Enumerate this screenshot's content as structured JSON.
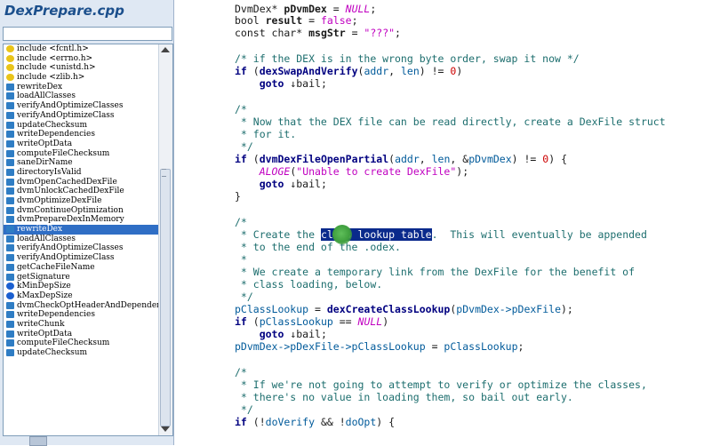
{
  "sidebar": {
    "file_title": "DexPrepare.cpp",
    "symbols": [
      {
        "icon": "include-icon",
        "label": "include <fcntl.h>"
      },
      {
        "icon": "include-icon",
        "label": "include <errno.h>"
      },
      {
        "icon": "include-icon",
        "label": "include <unistd.h>"
      },
      {
        "icon": "include-icon",
        "label": "include <zlib.h>"
      },
      {
        "icon": "method-icon",
        "label": "rewriteDex"
      },
      {
        "icon": "method-icon",
        "label": "loadAllClasses"
      },
      {
        "icon": "method-icon",
        "label": "verifyAndOptimizeClasses"
      },
      {
        "icon": "method-icon",
        "label": "verifyAndOptimizeClass"
      },
      {
        "icon": "method-icon",
        "label": "updateChecksum"
      },
      {
        "icon": "method-icon",
        "label": "writeDependencies"
      },
      {
        "icon": "method-icon",
        "label": "writeOptData"
      },
      {
        "icon": "method-icon",
        "label": "computeFileChecksum"
      },
      {
        "icon": "method-icon",
        "label": "saneDirName"
      },
      {
        "icon": "method-icon",
        "label": "directoryIsValid"
      },
      {
        "icon": "method-icon",
        "label": "dvmOpenCachedDexFile"
      },
      {
        "icon": "method-icon",
        "label": "dvmUnlockCachedDexFile"
      },
      {
        "icon": "method-icon",
        "label": "dvmOptimizeDexFile"
      },
      {
        "icon": "method-icon",
        "label": "dvmContinueOptimization"
      },
      {
        "icon": "method-icon",
        "label": "dvmPrepareDexInMemory"
      },
      {
        "icon": "method-icon",
        "label": "rewriteDex",
        "selected": true
      },
      {
        "icon": "method-icon",
        "label": "loadAllClasses"
      },
      {
        "icon": "method-icon",
        "label": "verifyAndOptimizeClasses"
      },
      {
        "icon": "method-icon",
        "label": "verifyAndOptimizeClass"
      },
      {
        "icon": "method-icon",
        "label": "getCacheFileName"
      },
      {
        "icon": "method-icon",
        "label": "getSignature"
      },
      {
        "icon": "variable-icon",
        "label": "kMinDepSize"
      },
      {
        "icon": "variable-icon",
        "label": "kMaxDepSize"
      },
      {
        "icon": "method-icon",
        "label": "dvmCheckOptHeaderAndDependencies"
      },
      {
        "icon": "method-icon",
        "label": "writeDependencies"
      },
      {
        "icon": "method-icon",
        "label": "writeChunk"
      },
      {
        "icon": "method-icon",
        "label": "writeOptData"
      },
      {
        "icon": "method-icon",
        "label": "computeFileChecksum"
      },
      {
        "icon": "method-icon",
        "label": "updateChecksum"
      }
    ]
  },
  "code": {
    "lines": [
      [
        {
          "c": "pl",
          "t": "DvmDex* "
        },
        {
          "c": "bold",
          "t": "pDvmDex"
        },
        {
          "c": "pl",
          "t": " = "
        },
        {
          "c": "macro",
          "t": "NULL"
        },
        {
          "c": "pl",
          "t": ";"
        }
      ],
      [
        {
          "c": "pl",
          "t": "bool "
        },
        {
          "c": "bold",
          "t": "result"
        },
        {
          "c": "pl",
          "t": " = "
        },
        {
          "c": "str",
          "t": "false"
        },
        {
          "c": "pl",
          "t": ";"
        }
      ],
      [
        {
          "c": "pl",
          "t": "const char* "
        },
        {
          "c": "bold",
          "t": "msgStr"
        },
        {
          "c": "pl",
          "t": " = "
        },
        {
          "c": "str",
          "t": "\"???\""
        },
        {
          "c": "pl",
          "t": ";"
        }
      ],
      [],
      [
        {
          "c": "cmt",
          "t": "/* if the DEX is in the wrong byte order, swap it now */"
        }
      ],
      [
        {
          "c": "kw",
          "t": "if"
        },
        {
          "c": "pl",
          "t": " ("
        },
        {
          "c": "fn",
          "t": "dexSwapAndVerify"
        },
        {
          "c": "pl",
          "t": "("
        },
        {
          "c": "var",
          "t": "addr"
        },
        {
          "c": "pl",
          "t": ", "
        },
        {
          "c": "var",
          "t": "len"
        },
        {
          "c": "pl",
          "t": ") != "
        },
        {
          "c": "num",
          "t": "0"
        },
        {
          "c": "pl",
          "t": ")"
        }
      ],
      [
        {
          "c": "pl",
          "t": "    "
        },
        {
          "c": "kw",
          "t": "goto"
        },
        {
          "c": "pl",
          "t": " ↓bail;"
        }
      ],
      [],
      [
        {
          "c": "cmt",
          "t": "/*"
        }
      ],
      [
        {
          "c": "cmt",
          "t": " * Now that the DEX file can be read directly, create a DexFile struct"
        }
      ],
      [
        {
          "c": "cmt",
          "t": " * for it."
        }
      ],
      [
        {
          "c": "cmt",
          "t": " */"
        }
      ],
      [
        {
          "c": "kw",
          "t": "if"
        },
        {
          "c": "pl",
          "t": " ("
        },
        {
          "c": "fn",
          "t": "dvmDexFileOpenPartial"
        },
        {
          "c": "pl",
          "t": "("
        },
        {
          "c": "var",
          "t": "addr"
        },
        {
          "c": "pl",
          "t": ", "
        },
        {
          "c": "var",
          "t": "len"
        },
        {
          "c": "pl",
          "t": ", &"
        },
        {
          "c": "var",
          "t": "pDvmDex"
        },
        {
          "c": "pl",
          "t": ") != "
        },
        {
          "c": "num",
          "t": "0"
        },
        {
          "c": "pl",
          "t": ") {"
        }
      ],
      [
        {
          "c": "pl",
          "t": "    "
        },
        {
          "c": "macro",
          "t": "ALOGE"
        },
        {
          "c": "pl",
          "t": "("
        },
        {
          "c": "str",
          "t": "\"Unable to create DexFile\""
        },
        {
          "c": "pl",
          "t": ");"
        }
      ],
      [
        {
          "c": "pl",
          "t": "    "
        },
        {
          "c": "kw",
          "t": "goto"
        },
        {
          "c": "pl",
          "t": " ↓bail;"
        }
      ],
      [
        {
          "c": "pl",
          "t": "}"
        }
      ],
      [],
      [
        {
          "c": "cmt",
          "t": "/*"
        }
      ],
      [
        {
          "c": "cmt",
          "t": " * Create the "
        },
        {
          "c": "sel",
          "t": "class lookup table"
        },
        {
          "c": "cmt",
          "t": ".  This will eventually be appended"
        }
      ],
      [
        {
          "c": "cmt",
          "t": " * to the end of the .odex."
        }
      ],
      [
        {
          "c": "cmt",
          "t": " *"
        }
      ],
      [
        {
          "c": "cmt",
          "t": " * We create a temporary link from the DexFile for the benefit of"
        }
      ],
      [
        {
          "c": "cmt",
          "t": " * class loading, below."
        }
      ],
      [
        {
          "c": "cmt",
          "t": " */"
        }
      ],
      [
        {
          "c": "var",
          "t": "pClassLookup"
        },
        {
          "c": "pl",
          "t": " = "
        },
        {
          "c": "fn",
          "t": "dexCreateClassLookup"
        },
        {
          "c": "pl",
          "t": "("
        },
        {
          "c": "var",
          "t": "pDvmDex->pDexFile"
        },
        {
          "c": "pl",
          "t": ");"
        }
      ],
      [
        {
          "c": "kw",
          "t": "if"
        },
        {
          "c": "pl",
          "t": " ("
        },
        {
          "c": "var",
          "t": "pClassLookup"
        },
        {
          "c": "pl",
          "t": " == "
        },
        {
          "c": "macro",
          "t": "NULL"
        },
        {
          "c": "pl",
          "t": ")"
        }
      ],
      [
        {
          "c": "pl",
          "t": "    "
        },
        {
          "c": "kw",
          "t": "goto"
        },
        {
          "c": "pl",
          "t": " ↓bail;"
        }
      ],
      [
        {
          "c": "var",
          "t": "pDvmDex->pDexFile->pClassLookup"
        },
        {
          "c": "pl",
          "t": " = "
        },
        {
          "c": "var",
          "t": "pClassLookup"
        },
        {
          "c": "pl",
          "t": ";"
        }
      ],
      [],
      [
        {
          "c": "cmt",
          "t": "/*"
        }
      ],
      [
        {
          "c": "cmt",
          "t": " * If we're not going to attempt to verify or optimize the classes,"
        }
      ],
      [
        {
          "c": "cmt",
          "t": " * there's no value in loading them, so bail out early."
        }
      ],
      [
        {
          "c": "cmt",
          "t": " */"
        }
      ],
      [
        {
          "c": "kw",
          "t": "if"
        },
        {
          "c": "pl",
          "t": " (!"
        },
        {
          "c": "var",
          "t": "doVerify"
        },
        {
          "c": "pl",
          "t": " && !"
        },
        {
          "c": "var",
          "t": "doOpt"
        },
        {
          "c": "pl",
          "t": ") {"
        }
      ]
    ]
  }
}
